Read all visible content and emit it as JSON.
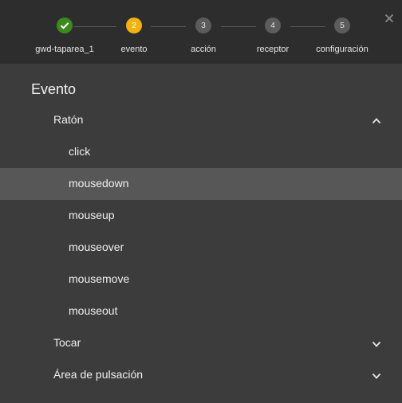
{
  "stepper": {
    "steps": [
      {
        "number": "",
        "label": "gwd-taparea_1",
        "state": "done"
      },
      {
        "number": "2",
        "label": "evento",
        "state": "active"
      },
      {
        "number": "3",
        "label": "acción",
        "state": "pending"
      },
      {
        "number": "4",
        "label": "receptor",
        "state": "pending"
      },
      {
        "number": "5",
        "label": "configuración",
        "state": "pending"
      }
    ],
    "colors": {
      "done": "#3c8a1e",
      "active": "#f2b20f",
      "pending": "#5c5c5c"
    }
  },
  "close_icon": "close-icon",
  "content": {
    "title": "Evento",
    "groups": [
      {
        "label": "Ratón",
        "expanded": true,
        "icon": "chevron-up-icon",
        "items": [
          {
            "label": "click",
            "selected": false
          },
          {
            "label": "mousedown",
            "selected": true
          },
          {
            "label": "mouseup",
            "selected": false
          },
          {
            "label": "mouseover",
            "selected": false
          },
          {
            "label": "mousemove",
            "selected": false
          },
          {
            "label": "mouseout",
            "selected": false
          }
        ]
      },
      {
        "label": "Tocar",
        "expanded": false,
        "icon": "chevron-down-icon"
      },
      {
        "label": "Área de pulsación",
        "expanded": false,
        "icon": "chevron-down-icon"
      }
    ]
  }
}
